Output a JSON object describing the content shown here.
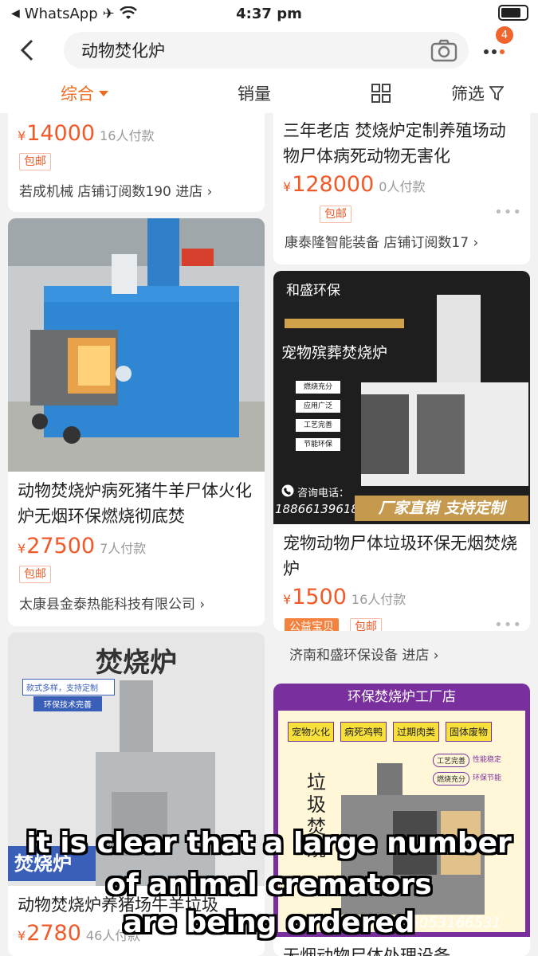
{
  "status_bar": {
    "back_app": "WhatsApp",
    "time": "4:37 pm",
    "badge": "4"
  },
  "search": {
    "query": "动物焚化炉"
  },
  "sort_bar": {
    "comprehensive": "综合",
    "sales": "销量",
    "filter": "筛选"
  },
  "left_column": [
    {
      "price": "14000",
      "paid": "16人付款",
      "tag": "包邮",
      "shop": "若成机械 店铺订阅数190 进店 ›"
    },
    {
      "title": "动物焚烧炉病死猪牛羊尸体火化炉无烟环保燃烧彻底焚",
      "price": "27500",
      "paid": "7人付款",
      "tag": "包邮",
      "shop": "太康县金泰热能科技有限公司 ›"
    },
    {
      "image_text": "焚烧炉",
      "image_banner": "焚烧炉",
      "img_tag1": "款式多样，支持定制",
      "img_tag2": "环保技术完善",
      "title": "动物焚烧炉养猪场牛羊垃圾",
      "price": "2780",
      "paid": "46人付款"
    }
  ],
  "right_column": [
    {
      "title": "三年老店 焚烧炉定制养殖场动物尸体病死动物无害化",
      "price": "128000",
      "paid": "0人付款",
      "tag": "包邮",
      "shop": "康泰隆智能装备 店铺订阅数17 ›"
    },
    {
      "img_brand": "和盛环保",
      "img_headline": "宠物殡葬焚烧炉",
      "img_features": [
        "燃烧充分",
        "应用广泛",
        "工艺完善",
        "节能环保"
      ],
      "img_phone_label": "咨询电话：",
      "img_phone": "18866139618",
      "img_slogan": "厂家直销 支持定制",
      "title": "宠物动物尸体垃圾环保无烟焚烧炉",
      "price": "1500",
      "paid": "16人付款",
      "tag1": "公益宝贝",
      "tag2": "包邮",
      "shop": "济南和盛环保设备 进店 ›"
    },
    {
      "img_header": "环保焚烧炉工厂店",
      "img_tags": [
        "宠物火化",
        "病死鸡鸭",
        "过期肉类",
        "固体废物"
      ],
      "img_side": [
        "工艺完善",
        "性能稳定",
        "燃烧充分",
        "环保节能"
      ],
      "img_vertical": "垃圾焚烧",
      "img_phone": "15053166531",
      "title": "无烟动物尸体处理设备"
    }
  ],
  "subtitle": {
    "line1": "it is clear that a large number",
    "line2": "of animal cremators",
    "line3": "are being ordered"
  }
}
